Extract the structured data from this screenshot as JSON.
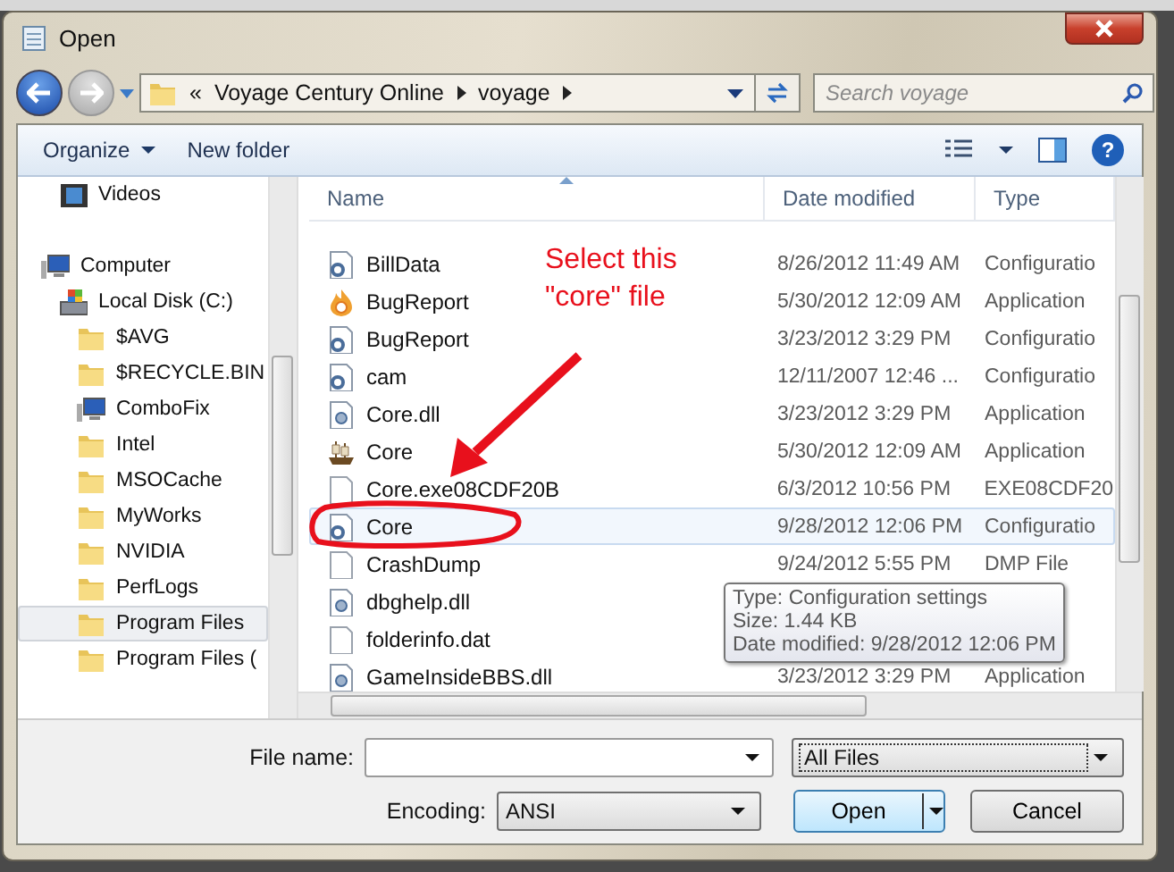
{
  "window": {
    "title": "Open"
  },
  "address": {
    "overflow": "«",
    "crumbs": [
      "Voyage Century Online",
      "voyage"
    ]
  },
  "search": {
    "placeholder": "Search voyage"
  },
  "toolbar": {
    "organize": "Organize",
    "new_folder": "New folder",
    "help": "?"
  },
  "sidebar": {
    "items": [
      {
        "label": "Videos",
        "kind": "videos",
        "selected": false
      },
      {
        "label": "Computer",
        "kind": "computer",
        "selected": false,
        "children": [
          {
            "label": "Local Disk (C:)",
            "kind": "disk",
            "selected": false,
            "children": [
              {
                "label": "$AVG",
                "kind": "folder",
                "selected": false
              },
              {
                "label": "$RECYCLE.BIN",
                "kind": "folder",
                "selected": false
              },
              {
                "label": "ComboFix",
                "kind": "computer",
                "selected": false
              },
              {
                "label": "Intel",
                "kind": "folder",
                "selected": false
              },
              {
                "label": "MSOCache",
                "kind": "folder",
                "selected": false
              },
              {
                "label": "MyWorks",
                "kind": "folder",
                "selected": false
              },
              {
                "label": "NVIDIA",
                "kind": "folder",
                "selected": false
              },
              {
                "label": "PerfLogs",
                "kind": "folder",
                "selected": false
              },
              {
                "label": "Program Files",
                "kind": "folder",
                "selected": true
              },
              {
                "label": "Program Files (",
                "kind": "folder",
                "selected": false
              }
            ]
          }
        ]
      }
    ]
  },
  "table": {
    "columns": [
      "Name",
      "Date modified",
      "Type"
    ],
    "rows": [
      {
        "name": "BillData",
        "date": "8/26/2012 11:49 AM",
        "type": "Configuratio",
        "kind": "config",
        "hovered": false
      },
      {
        "name": "BugReport",
        "date": "5/30/2012 12:09 AM",
        "type": "Application",
        "kind": "flame",
        "hovered": false
      },
      {
        "name": "BugReport",
        "date": "3/23/2012 3:29 PM",
        "type": "Configuratio",
        "kind": "config",
        "hovered": false
      },
      {
        "name": "cam",
        "date": "12/11/2007 12:46 ...",
        "type": "Configuratio",
        "kind": "config",
        "hovered": false
      },
      {
        "name": "Core.dll",
        "date": "3/23/2012 3:29 PM",
        "type": "Application",
        "kind": "dll",
        "hovered": false
      },
      {
        "name": "Core",
        "date": "5/30/2012 12:09 AM",
        "type": "Application",
        "kind": "app",
        "hovered": false
      },
      {
        "name": "Core.exe08CDF20B",
        "date": "6/3/2012 10:56 PM",
        "type": "EXE08CDF20",
        "kind": "blank",
        "hovered": false
      },
      {
        "name": "Core",
        "date": "9/28/2012 12:06 PM",
        "type": "Configuratio",
        "kind": "config",
        "hovered": true
      },
      {
        "name": "CrashDump",
        "date": "9/24/2012 5:55 PM",
        "type": "DMP File",
        "kind": "blank",
        "hovered": false
      },
      {
        "name": "dbghelp.dll",
        "kind": "dll",
        "hovered": false
      },
      {
        "name": "folderinfo.dat",
        "kind": "blank",
        "hovered": false
      },
      {
        "name": "GameInsideBBS.dll",
        "date": "3/23/2012 3:29 PM",
        "type": "Application",
        "kind": "dll",
        "hovered": false
      }
    ]
  },
  "tooltip": [
    "Type: Configuration settings",
    "Size: 1.44 KB",
    "Date modified: 9/28/2012 12:06 PM"
  ],
  "annotation": {
    "text": [
      "Select this",
      "\"core\" file"
    ]
  },
  "footer": {
    "file_name_label": "File name:",
    "filter": "All Files",
    "encoding_label": "Encoding:",
    "encoding": "ANSI",
    "open": "Open",
    "cancel": "Cancel"
  }
}
